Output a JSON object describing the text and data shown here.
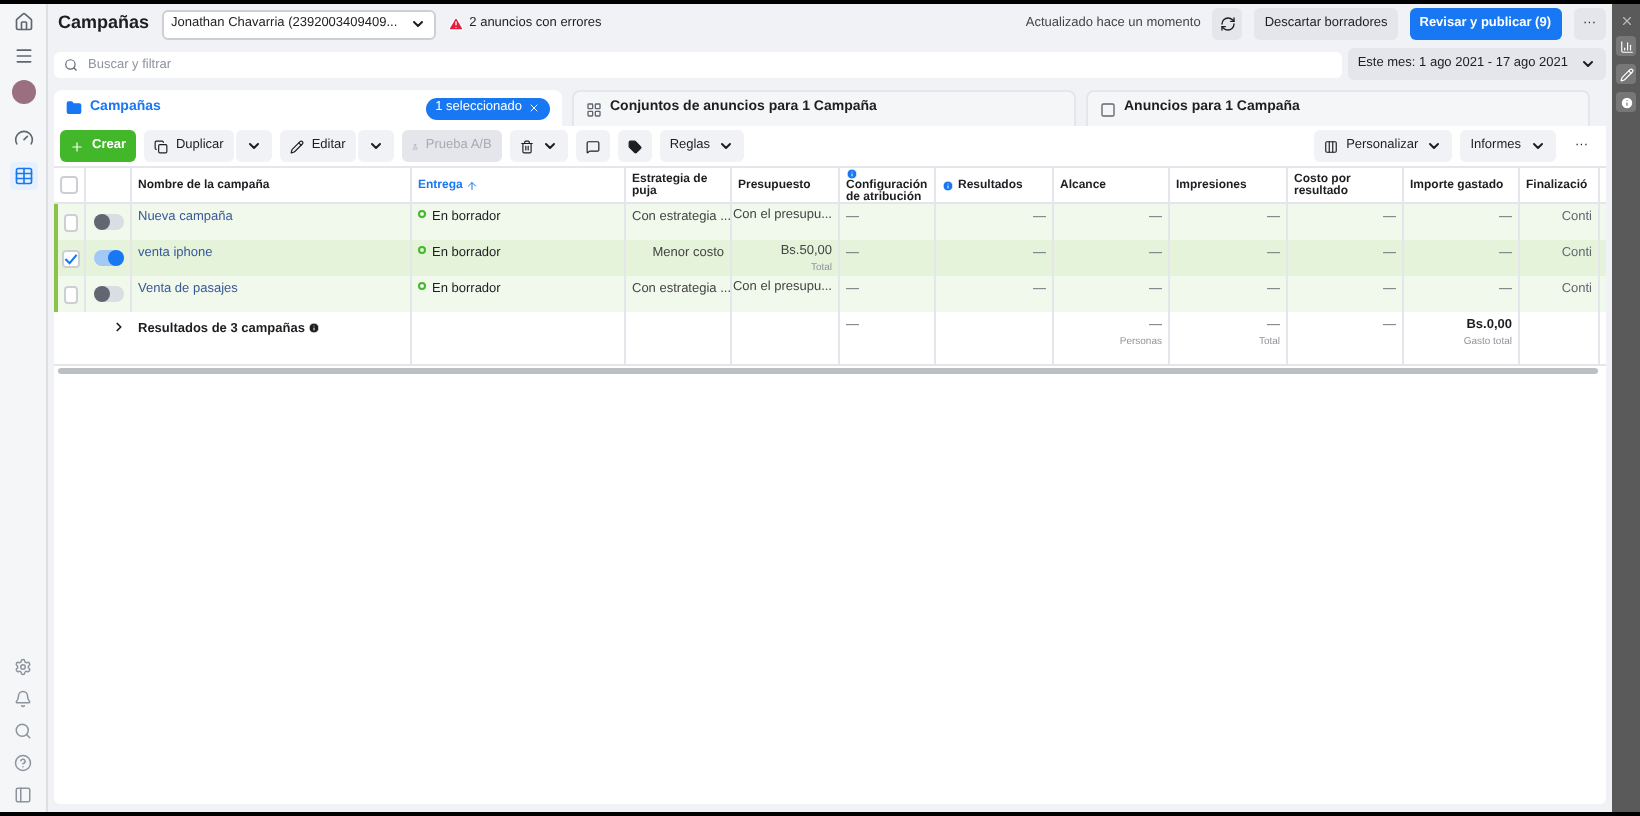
{
  "header": {
    "title": "Campañas",
    "account": "Jonathan Chavarria (2392003409409...",
    "errors": "2 anuncios con errores",
    "updated": "Actualizado hace un momento",
    "discard": "Descartar borradores",
    "publish": "Revisar y publicar (9)",
    "more": "···"
  },
  "search": {
    "placeholder": "Buscar y filtrar",
    "date_range": "Este mes: 1 ago 2021 - 17 ago 2021"
  },
  "tabs": [
    {
      "label": "Campañas",
      "selected": true,
      "badge": "1 seleccionado"
    },
    {
      "label": "Conjuntos de anuncios para 1 Campaña",
      "selected": false
    },
    {
      "label": "Anuncios para 1 Campaña",
      "selected": false
    }
  ],
  "toolbar": {
    "create": "Crear",
    "duplicate": "Duplicar",
    "edit": "Editar",
    "ab_test": "Prueba A/B",
    "ab_test_disabled": true,
    "rules": "Reglas",
    "customize": "Personalizar",
    "reports": "Informes",
    "more": "···"
  },
  "table": {
    "all_selected": false,
    "columns": [
      {
        "label": "Nombre de la campaña",
        "info": false,
        "sorted": false
      },
      {
        "label": "Entrega",
        "info": false,
        "sorted": true
      },
      {
        "label": "Estrategia de puja",
        "info": false,
        "sorted": false
      },
      {
        "label": "Presupuesto",
        "info": false,
        "sorted": false
      },
      {
        "label": "Configuración de atribución",
        "info": true,
        "sorted": false
      },
      {
        "label": "Resultados",
        "info": true,
        "sorted": false
      },
      {
        "label": "Alcance",
        "info": false,
        "sorted": false
      },
      {
        "label": "Impresiones",
        "info": false,
        "sorted": false
      },
      {
        "label": "Costo por resultado",
        "info": false,
        "sorted": false
      },
      {
        "label": "Importe gastado",
        "info": false,
        "sorted": false
      },
      {
        "label": "Finalizació",
        "info": false,
        "sorted": false
      }
    ],
    "rows": [
      {
        "name": "Nueva campaña",
        "selected": false,
        "on": false,
        "delivery": "En borrador",
        "strategy": "Con estrategia ...",
        "budget": "Con el presupu...",
        "values": [
          "—",
          "—",
          "—",
          "—",
          "—",
          "—",
          "Conti"
        ]
      },
      {
        "name": "venta iphone",
        "selected": true,
        "on": true,
        "delivery": "En borrador",
        "strategy": "Menor costo",
        "budget": "Bs.50,00",
        "budget_note": "Total",
        "values": [
          "—",
          "—",
          "—",
          "—",
          "—",
          "—",
          "Conti"
        ]
      },
      {
        "name": "Venta de pasajes",
        "selected": false,
        "on": false,
        "delivery": "En borrador",
        "strategy": "Con estrategia ...",
        "budget": "Con el presupu...",
        "values": [
          "—",
          "—",
          "—",
          "—",
          "—",
          "—",
          "Conti"
        ]
      }
    ],
    "summary": {
      "label": "Resultados de 3 campañas",
      "values": [
        {
          "kind": "value",
          "value": "—"
        },
        {
          "kind": "empty"
        },
        {
          "kind": "value",
          "value": "—",
          "note": "Personas"
        },
        {
          "kind": "value",
          "value": "—",
          "note": "Total"
        },
        {
          "kind": "value",
          "value": "—"
        },
        {
          "kind": "total",
          "value": "Bs.0,00",
          "note": "Gasto total"
        },
        {
          "kind": "empty"
        }
      ]
    }
  }
}
